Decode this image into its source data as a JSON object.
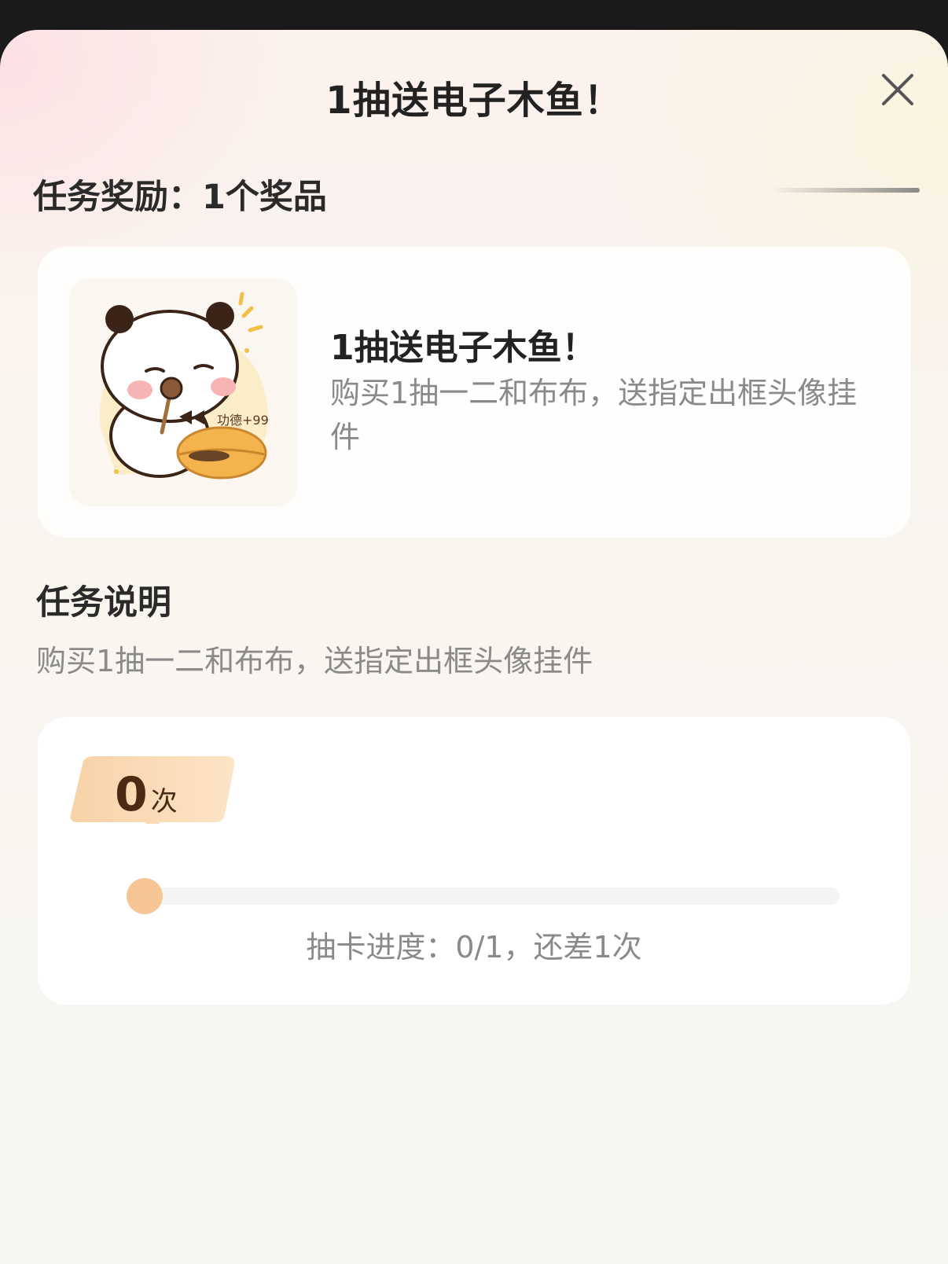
{
  "header": {
    "title": "1抽送电子木鱼！",
    "close_icon": "close-icon"
  },
  "reward": {
    "section_title": "任务奖励：1个奖品",
    "prize": {
      "name": "1抽送电子木鱼！",
      "description": "购买1抽一二和布布，送指定出框头像挂件",
      "image": "panda-woodfish-sticker",
      "image_caption": "功德+99"
    }
  },
  "task": {
    "section_title": "任务说明",
    "description": "购买1抽一二和布布，送指定出框头像挂件"
  },
  "progress": {
    "count": "0",
    "count_unit": "次",
    "current": 0,
    "total": 1,
    "fraction": 0,
    "status_text": "抽卡进度：0/1，还差1次",
    "accent_color": "#f6c596"
  }
}
